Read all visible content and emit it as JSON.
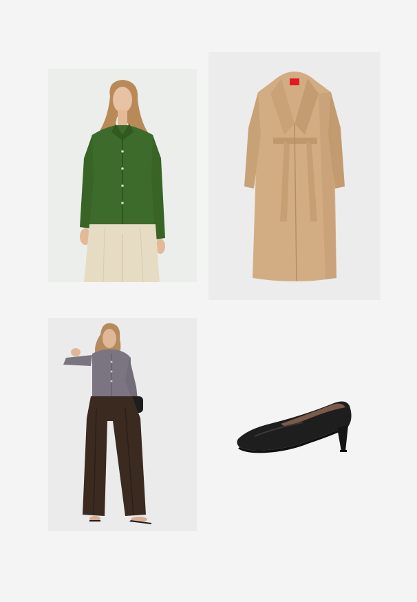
{
  "board": {
    "background": "#f4f4f4",
    "items": [
      {
        "id": "blouse",
        "kind": "product-photo",
        "subject": "green-silk-blouse",
        "colors": {
          "garment": "#3c6b2b",
          "trousers": "#e6dcc4"
        }
      },
      {
        "id": "coat",
        "kind": "product-photo",
        "subject": "camel-wrap-coat",
        "colors": {
          "garment": "#d2ad84",
          "label": "#e21b23"
        }
      },
      {
        "id": "outfit",
        "kind": "product-photo",
        "subject": "grey-knit-and-brown-wide-trousers",
        "colors": {
          "top": "#7a7580",
          "trousers": "#3b2a20"
        }
      },
      {
        "id": "pump",
        "kind": "product-photo",
        "subject": "black-leather-pump",
        "colors": {
          "shoe": "#1e1e1e"
        }
      }
    ]
  }
}
